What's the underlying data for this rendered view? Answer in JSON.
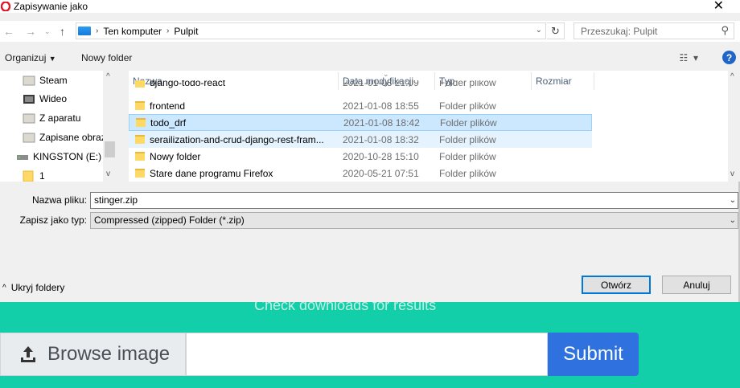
{
  "background_page": {
    "hint": "Check downloads for results",
    "browse_label": "Browse image",
    "submit_label": "Submit",
    "url_value": ""
  },
  "dialog": {
    "title": "Zapisywanie jako",
    "close": "✕",
    "path": [
      "Ten komputer",
      "Pulpit"
    ],
    "search_placeholder": "Przeszukaj: Pulpit",
    "toolbar": {
      "organize": "Organizuj",
      "new_folder": "Nowy folder",
      "help": "?"
    },
    "tree": [
      {
        "label": "Steam",
        "icon": "folder-icon"
      },
      {
        "label": "Wideo",
        "icon": "video-folder-icon"
      },
      {
        "label": "Z aparatu",
        "icon": "folder-icon"
      },
      {
        "label": "Zapisane obraz",
        "icon": "folder-icon"
      },
      {
        "label": "KINGSTON (E:)",
        "icon": "drive-icon"
      },
      {
        "label": "1",
        "icon": "folder-icon"
      }
    ],
    "columns": [
      "Nazwa",
      "Data modyfikacji",
      "Typ",
      "Rozmiar"
    ],
    "files": [
      {
        "name": "django-todo-react",
        "date": "2021-01-08 21:09",
        "type": "Folder plików"
      },
      {
        "name": "frontend",
        "date": "2021-01-08 18:55",
        "type": "Folder plików"
      },
      {
        "name": "todo_drf",
        "date": "2021-01-08 18:42",
        "type": "Folder plików"
      },
      {
        "name": "serailization-and-crud-django-rest-fram...",
        "date": "2021-01-08 18:32",
        "type": "Folder plików"
      },
      {
        "name": "Nowy folder",
        "date": "2020-10-28 15:10",
        "type": "Folder plików"
      },
      {
        "name": "Stare dane programu Firefox",
        "date": "2020-05-21 07:51",
        "type": "Folder plików"
      }
    ],
    "filename_label": "Nazwa pliku:",
    "filename_value": "stinger.zip",
    "filetype_label": "Zapisz jako typ:",
    "filetype_value": "Compressed (zipped) Folder (*.zip)",
    "hide_folders": "Ukryj foldery",
    "save_label": "Otwórz",
    "cancel_label": "Anuluj"
  }
}
